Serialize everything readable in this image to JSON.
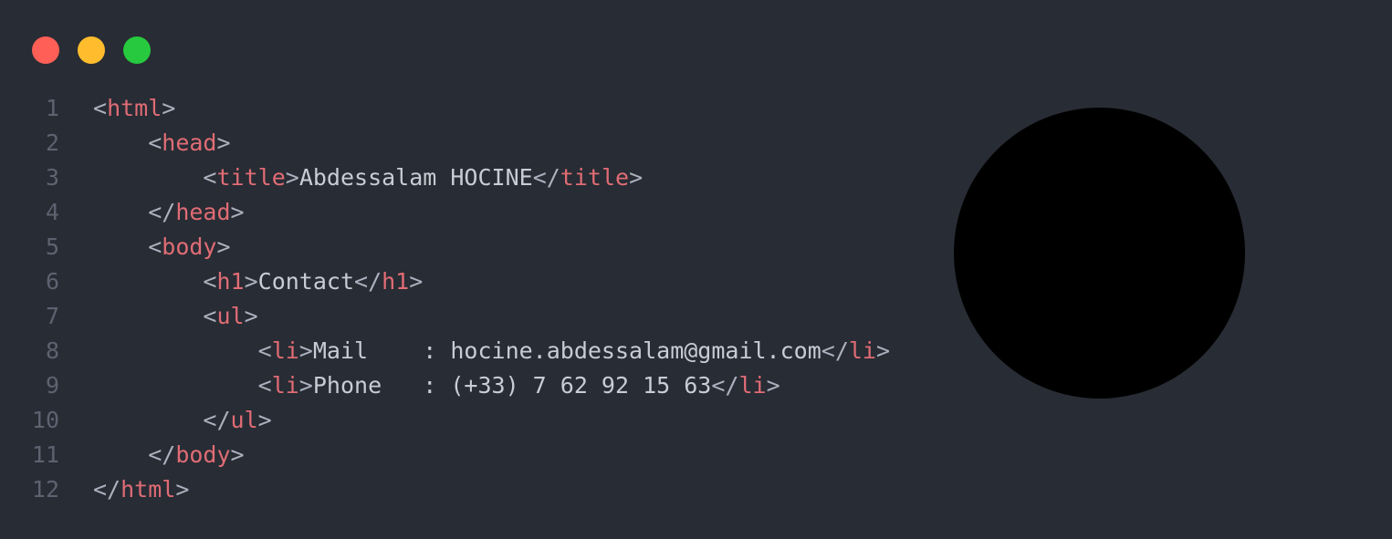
{
  "window": {
    "controls": [
      {
        "name": "close",
        "color": "#ff5f56"
      },
      {
        "name": "minimize",
        "color": "#ffbd2e"
      },
      {
        "name": "maximize",
        "color": "#27c93f"
      }
    ]
  },
  "colors": {
    "background": "#282c34",
    "line_number": "#5c6370",
    "punctuation": "#abb2bf",
    "tag": "#e06c75",
    "text": "#c8ccd4",
    "avatar": "#000000"
  },
  "code": {
    "lines": [
      {
        "num": "1",
        "indent": "",
        "tokens": [
          {
            "t": "p",
            "v": "<"
          },
          {
            "t": "tag",
            "v": "html"
          },
          {
            "t": "p",
            "v": ">"
          }
        ]
      },
      {
        "num": "2",
        "indent": "    ",
        "tokens": [
          {
            "t": "p",
            "v": "<"
          },
          {
            "t": "tag",
            "v": "head"
          },
          {
            "t": "p",
            "v": ">"
          }
        ]
      },
      {
        "num": "3",
        "indent": "        ",
        "tokens": [
          {
            "t": "p",
            "v": "<"
          },
          {
            "t": "tag",
            "v": "title"
          },
          {
            "t": "p",
            "v": ">"
          },
          {
            "t": "txt",
            "v": "Abdessalam HOCINE"
          },
          {
            "t": "p",
            "v": "</"
          },
          {
            "t": "tag",
            "v": "title"
          },
          {
            "t": "p",
            "v": ">"
          }
        ]
      },
      {
        "num": "4",
        "indent": "    ",
        "tokens": [
          {
            "t": "p",
            "v": "</"
          },
          {
            "t": "tag",
            "v": "head"
          },
          {
            "t": "p",
            "v": ">"
          }
        ]
      },
      {
        "num": "5",
        "indent": "    ",
        "tokens": [
          {
            "t": "p",
            "v": "<"
          },
          {
            "t": "tag",
            "v": "body"
          },
          {
            "t": "p",
            "v": ">"
          }
        ]
      },
      {
        "num": "6",
        "indent": "        ",
        "tokens": [
          {
            "t": "p",
            "v": "<"
          },
          {
            "t": "tag",
            "v": "h1"
          },
          {
            "t": "p",
            "v": ">"
          },
          {
            "t": "txt",
            "v": "Contact"
          },
          {
            "t": "p",
            "v": "</"
          },
          {
            "t": "tag",
            "v": "h1"
          },
          {
            "t": "p",
            "v": ">"
          }
        ]
      },
      {
        "num": "7",
        "indent": "        ",
        "tokens": [
          {
            "t": "p",
            "v": "<"
          },
          {
            "t": "tag",
            "v": "ul"
          },
          {
            "t": "p",
            "v": ">"
          }
        ]
      },
      {
        "num": "8",
        "indent": "            ",
        "tokens": [
          {
            "t": "p",
            "v": "<"
          },
          {
            "t": "tag",
            "v": "li"
          },
          {
            "t": "p",
            "v": ">"
          },
          {
            "t": "txt",
            "v": "Mail    : hocine.abdessalam@gmail.com"
          },
          {
            "t": "p",
            "v": "</"
          },
          {
            "t": "tag",
            "v": "li"
          },
          {
            "t": "p",
            "v": ">"
          }
        ]
      },
      {
        "num": "9",
        "indent": "            ",
        "tokens": [
          {
            "t": "p",
            "v": "<"
          },
          {
            "t": "tag",
            "v": "li"
          },
          {
            "t": "p",
            "v": ">"
          },
          {
            "t": "txt",
            "v": "Phone   : (+33) 7 62 92 15 63"
          },
          {
            "t": "p",
            "v": "</"
          },
          {
            "t": "tag",
            "v": "li"
          },
          {
            "t": "p",
            "v": ">"
          }
        ]
      },
      {
        "num": "10",
        "indent": "        ",
        "tokens": [
          {
            "t": "p",
            "v": "</"
          },
          {
            "t": "tag",
            "v": "ul"
          },
          {
            "t": "p",
            "v": ">"
          }
        ]
      },
      {
        "num": "11",
        "indent": "    ",
        "tokens": [
          {
            "t": "p",
            "v": "</"
          },
          {
            "t": "tag",
            "v": "body"
          },
          {
            "t": "p",
            "v": ">"
          }
        ]
      },
      {
        "num": "12",
        "indent": "",
        "tokens": [
          {
            "t": "p",
            "v": "</"
          },
          {
            "t": "tag",
            "v": "html"
          },
          {
            "t": "p",
            "v": ">"
          }
        ]
      }
    ]
  }
}
